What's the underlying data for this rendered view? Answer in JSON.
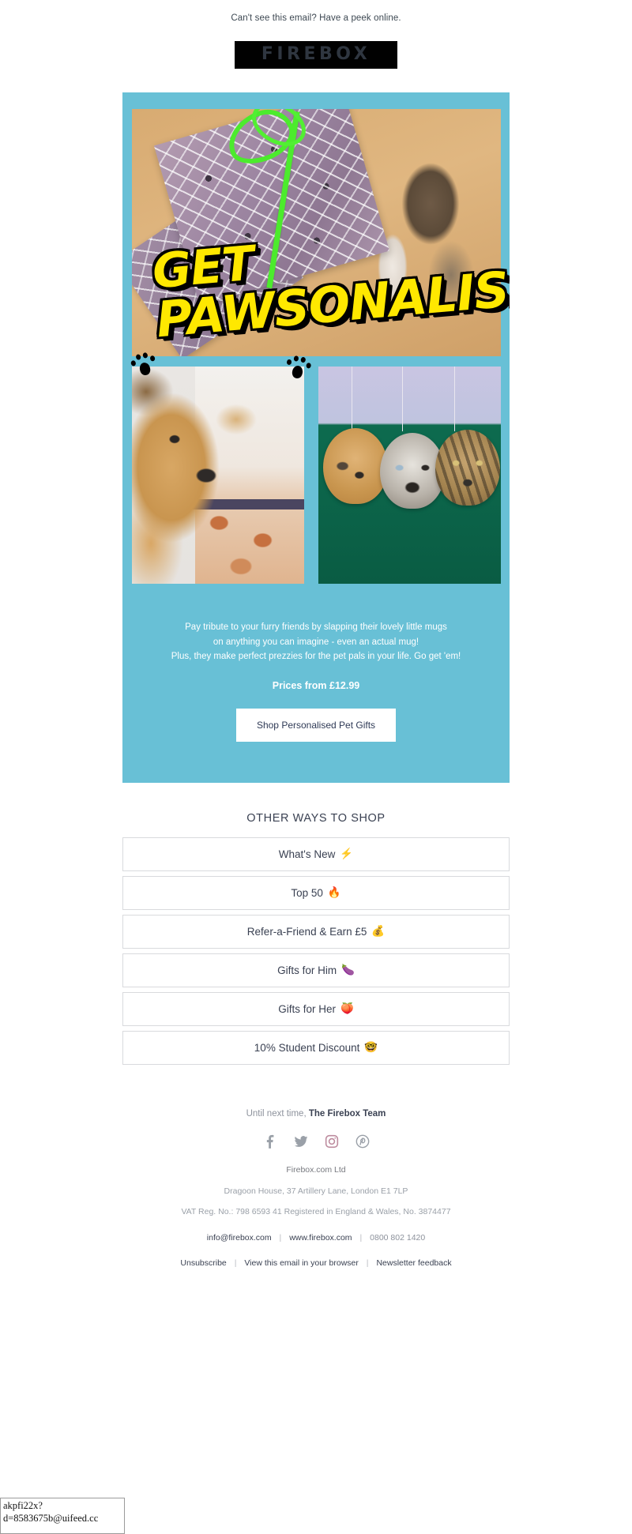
{
  "preheader": "Can't see this email? Have a peek online.",
  "brand": {
    "logo_text": "FIREBOX",
    "logo_bg": "#010101",
    "accent": "#68c0d6",
    "headline_yellow": "#ffe800"
  },
  "hero": {
    "headline_line1": "GET",
    "headline_line2": "PAWSONALISED",
    "body_line1": "Pay tribute to your furry friends by slapping their lovely little mugs",
    "body_line2": "on anything you can imagine - even an actual mug!",
    "body_line3": "Plus, they make perfect prezzies for the pet pals in your life. Go get 'em!",
    "price": "Prices from £12.99",
    "cta_label": "Shop Personalised Pet Gifts"
  },
  "other_ways": {
    "title": "OTHER WAYS TO SHOP",
    "items": [
      {
        "label": "What's New",
        "emoji": "⚡"
      },
      {
        "label": "Top 50",
        "emoji": "🔥"
      },
      {
        "label": "Refer-a-Friend & Earn £5",
        "emoji": "💰"
      },
      {
        "label": "Gifts for Him",
        "emoji": "🍆"
      },
      {
        "label": "Gifts for Her",
        "emoji": "🍑"
      },
      {
        "label": "10% Student Discount",
        "emoji": "🤓"
      }
    ]
  },
  "footer": {
    "signoff_prefix": "Until next time, ",
    "signoff_team": "The Firebox Team",
    "socials": [
      {
        "name": "facebook"
      },
      {
        "name": "twitter"
      },
      {
        "name": "instagram"
      },
      {
        "name": "pinterest"
      }
    ],
    "company": "Firebox.com Ltd",
    "address": "Dragoon House, 37 Artillery Lane, London E1 7LP",
    "vat": "VAT Reg. No.: 798 6593 41 Registered in England & Wales, No. 3874477",
    "contact_email": "info@firebox.com",
    "contact_site": "www.firebox.com",
    "contact_phone": "0800 802 1420",
    "link_unsubscribe": "Unsubscribe",
    "link_browser": "View this email in your browser",
    "link_feedback": "Newsletter feedback"
  },
  "tracker": {
    "line1": "akpfi22x?",
    "line2": "d=8583675b@uifeed.cc"
  }
}
